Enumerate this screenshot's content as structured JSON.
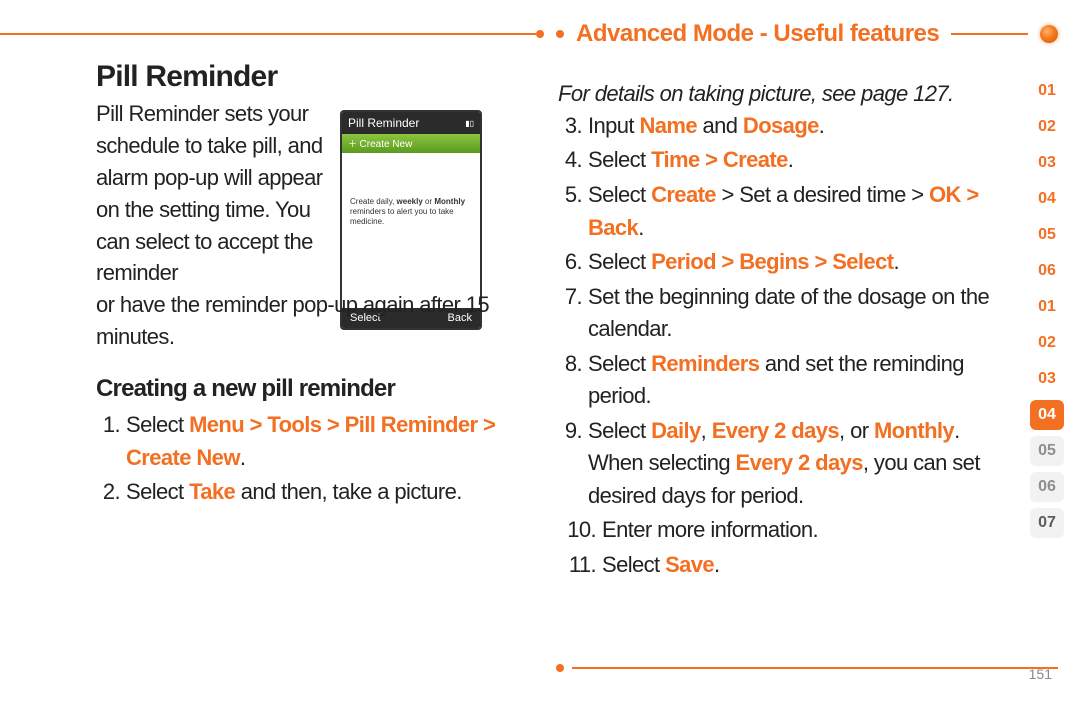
{
  "header": "Advanced Mode - Useful features",
  "page_number": "151",
  "left": {
    "title": "Pill Reminder",
    "intro_narrow": "Pill Reminder sets your schedule to take pill, and alarm pop-up will appear on the setting time. You can select to accept the reminder",
    "intro_wide": "or have the reminder pop-up again after 15 minutes.",
    "subhead": "Creating a new pill reminder",
    "step1_pre": "Select ",
    "step1_hi": "Menu > Tools > Pill Reminder > Create New",
    "step1_post": ".",
    "step2_pre": "Select ",
    "step2_hi": "Take",
    "step2_post": " and then, take a picture."
  },
  "right": {
    "note": "For details on taking picture, see page 127.",
    "s3a": "Input ",
    "s3b": "Name",
    "s3c": " and ",
    "s3d": "Dosage",
    "s3e": ".",
    "s4a": "Select ",
    "s4b": "Time > Create",
    "s4c": ".",
    "s5a": "Select ",
    "s5b": "Create",
    "s5c": " > Set a desired time > ",
    "s5d": "OK > Back",
    "s5e": ".",
    "s6a": "Select ",
    "s6b": "Period > Begins > Select",
    "s6c": ".",
    "s7": "Set the beginning date of the dosage on the calendar.",
    "s8a": "Select ",
    "s8b": "Reminders",
    "s8c": " and set the reminding period.",
    "s9a": "Select ",
    "s9b": "Daily",
    "s9c": ", ",
    "s9d": "Every 2 days",
    "s9e": ", or ",
    "s9f": "Monthly",
    "s9g": ". When selecting ",
    "s9h": "Every 2 days",
    "s9i": ", you can set desired days for period.",
    "s10": "Enter more information.",
    "s11a": "Select ",
    "s11b": "Save",
    "s11c": "."
  },
  "phone": {
    "title": "Pill Reminder",
    "create": "Create New",
    "body1": "Create daily, ",
    "body1b": "weekly",
    "body2": " or ",
    "body2b": "Monthly",
    "body3": " reminders to alert you to take medicine.",
    "footL": "Select",
    "footR": "Back"
  },
  "tabs": [
    "01",
    "02",
    "03",
    "04",
    "05",
    "06",
    "01",
    "02",
    "03",
    "04",
    "05",
    "06",
    "07"
  ],
  "tab_active_index": 9
}
